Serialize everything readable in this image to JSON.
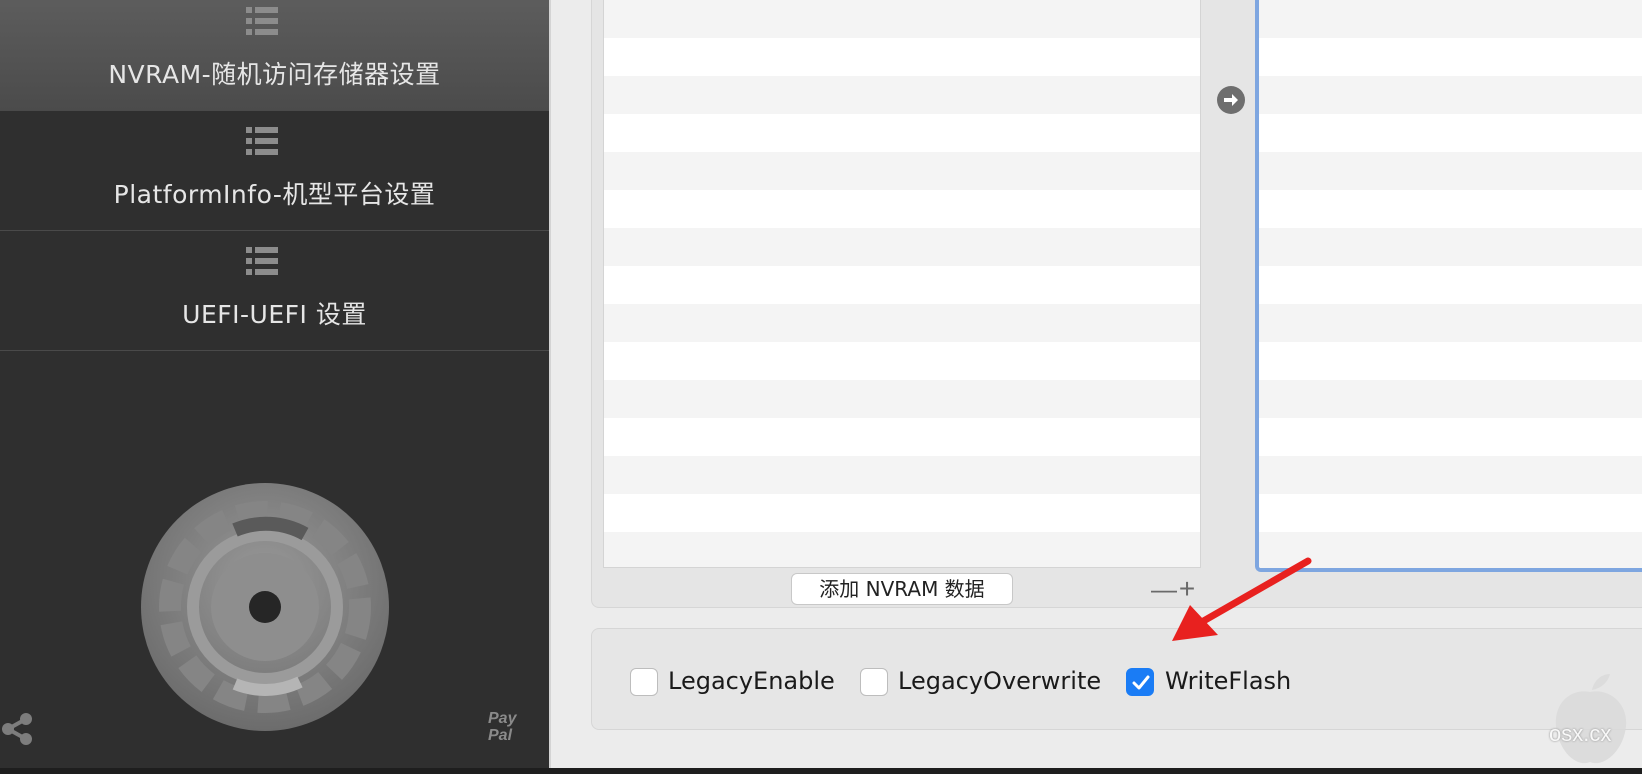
{
  "sidebar": {
    "items": [
      {
        "label": "NVRAM-随机访问存储器设置",
        "icon": "list-icon",
        "active": true
      },
      {
        "label": "PlatformInfo-机型平台设置",
        "icon": "list-icon",
        "active": false
      },
      {
        "label": "UEFI-UEFI 设置",
        "icon": "list-icon",
        "active": false
      }
    ],
    "logo_icon": "gear-icon",
    "share_icon": "share-icon",
    "paypal_line1": "Pay",
    "paypal_line2": "Pal"
  },
  "main": {
    "add_button_label": "添加 NVRAM 数据",
    "minus_label": "—",
    "plus_label": "+",
    "arrow_icon": "arrow-right-circle-icon",
    "options": [
      {
        "label": "LegacyEnable",
        "checked": false
      },
      {
        "label": "LegacyOverwrite",
        "checked": false
      },
      {
        "label": "WriteFlash",
        "checked": true
      }
    ]
  },
  "watermark": {
    "text": "osx.cx"
  },
  "colors": {
    "sidebar_bg": "#2f2f2f",
    "sidebar_active": "#555555",
    "accent_blue": "#1a7cf5",
    "selection_border": "#7ea6e0",
    "annotation_red": "#e8211f"
  }
}
